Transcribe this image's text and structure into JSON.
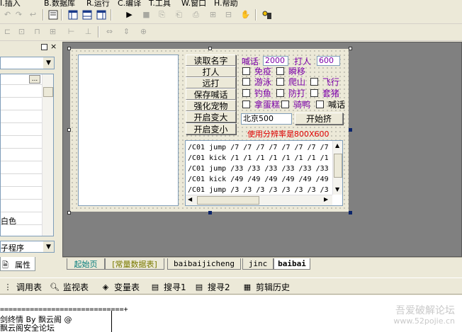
{
  "menu": {
    "items": [
      "I.插入",
      "B.数据库",
      "R.运行",
      "C.编译",
      "T.工具",
      "W.窗口",
      "H.帮助"
    ]
  },
  "icons": {
    "toolbar1": [
      "undo-icon",
      "redo-icon",
      "back-icon",
      "find-icon",
      "layout1-icon",
      "layout2-icon",
      "layout3-icon",
      "run-icon",
      "stop-icon",
      "step-icon",
      "step-into-icon",
      "step-out-icon",
      "watch-icon",
      "hand-icon",
      "debug-icon"
    ],
    "toolbar2": [
      "align-left-icon",
      "align-center-icon",
      "align-top-icon",
      "align-middle-icon",
      "space-horiz-icon",
      "space-vert-icon",
      "same-width-icon",
      "same-height-icon",
      "same-size-icon"
    ]
  },
  "left_panel": {
    "grid_ellipsis": "...",
    "white_color": "白色",
    "subprogram": "子程序",
    "tab_label": "属性"
  },
  "form": {
    "buttons": [
      "读取名字",
      "打人",
      "远打",
      "保存喊话",
      "强化宠物",
      "开启变大",
      "开启变小"
    ],
    "shout_label": "喊话",
    "shout_value": "2000",
    "hit_label": "打人",
    "hit_value": "600",
    "checkboxes_row1": [
      "免疫",
      "瞬移"
    ],
    "checkboxes_row2": [
      "游泳",
      "爬山",
      "飞行"
    ],
    "checkboxes_row3": [
      "钓鱼",
      "防打",
      "套猪"
    ],
    "checkboxes_row4": [
      "拿蛋糕",
      "骑鸭",
      "喊话"
    ],
    "city_value": "北京500",
    "start_button": "开始挤",
    "resolution_note": "使用分辨率是800X600",
    "code_lines": [
      "/C01 jump /7 /7 /7 /7 /7 /7 /7 /7",
      "/C01 kick /1 /1 /1 /1 /1 /1 /1 /1",
      "/C01 jump /33 /33 /33 /33 /33 /33",
      "/C01 kick /49 /49 /49 /49 /49 /49",
      "/C01 jump /3 /3 /3 /3 /3 /3 /3 /3"
    ]
  },
  "editor_tabs": [
    "起始页",
    "[常量数据表]",
    "baibaijicheng",
    "jinc",
    "baibai"
  ],
  "bottom_tools": [
    "调用表",
    "监视表",
    "变量表",
    "搜寻1",
    "搜寻2",
    "剪辑历史"
  ],
  "output": {
    "separator": "=============================+",
    "line1": "剑终情 By 飘云阁 @",
    "line2": "飘云阁安全论坛"
  },
  "watermark": {
    "line1": "吾爱破解论坛",
    "line2": "www.52pojie.cn"
  },
  "colors": {
    "form_purple": "#7b00a8",
    "note_red": "#e00000",
    "tab_teal": "#007a7a",
    "tab_olive": "#7a7a00",
    "design_gray": "#808080"
  }
}
